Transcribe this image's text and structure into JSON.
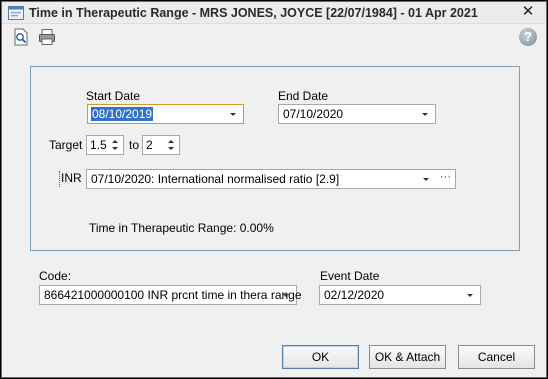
{
  "window": {
    "title": "Time in Therapeutic Range - MRS JONES, JOYCE [22/07/1984] - 01 Apr 2021",
    "close_glyph": "✕"
  },
  "toolbar": {
    "icons": [
      "preview-icon",
      "print-icon"
    ],
    "help_glyph": "?"
  },
  "form": {
    "start_date_label": "Start Date",
    "start_date_value": "08/10/2019",
    "end_date_label": "End Date",
    "end_date_value": "07/10/2020",
    "target_label": "Target",
    "target_low": "1.5",
    "target_to_label": "to",
    "target_high": "2",
    "inr_label": "INR",
    "inr_value": "07/10/2020: International normalised ratio [2.9]",
    "inr_ellipsis": "···",
    "ttr_text": "Time in Therapeutic Range: 0.00%"
  },
  "code": {
    "label": "Code:",
    "value": "866421000000100 INR prcnt time in thera range"
  },
  "event_date": {
    "label": "Event Date",
    "value": "02/12/2020"
  },
  "buttons": {
    "ok": "OK",
    "ok_attach": "OK & Attach",
    "cancel": "Cancel"
  }
}
